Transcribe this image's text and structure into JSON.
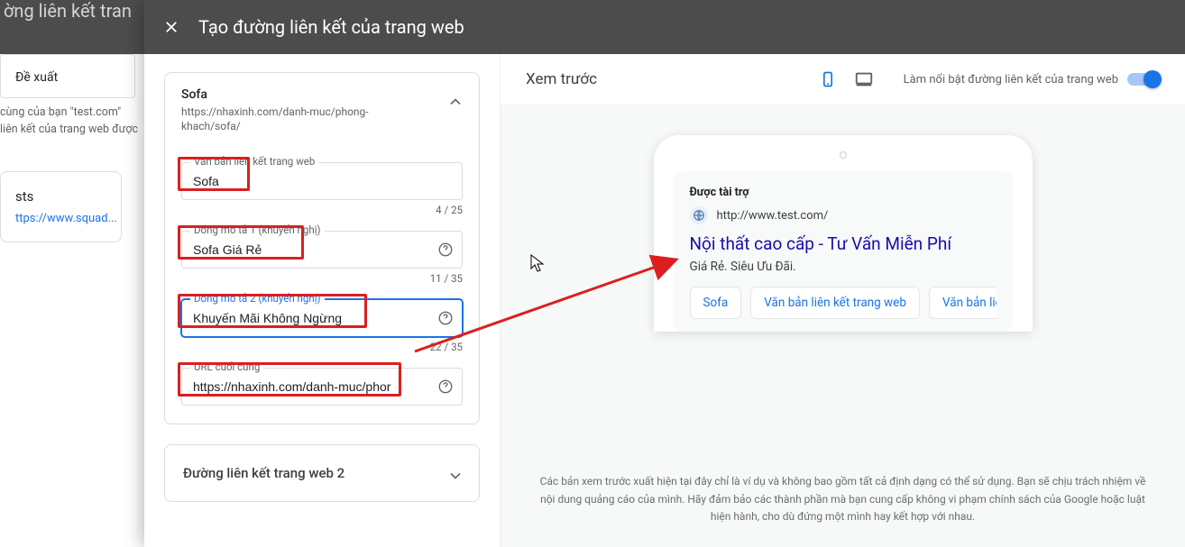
{
  "background": {
    "top_crumb": "ờng liên kết tran",
    "tab": "Đề xuất",
    "line1": "cùng của bạn \"test.com\"",
    "line2": "liên kết của trang web được",
    "card_title": "sts",
    "card_link": "ttps://www.squad..."
  },
  "dialog": {
    "title": "Tạo đường liên kết của trang web",
    "cards": [
      {
        "title": "Sofa",
        "url": "https://nhaxinh.com/danh-muc/phong-khach/sofa/",
        "fields": {
          "link_text": {
            "label": "Văn bản liên kết trang web",
            "value": "Sofa",
            "counter": "4 / 25"
          },
          "desc1": {
            "label": "Dòng mô tả 1 (khuyến nghị)",
            "value": "Sofa Giá Rẻ",
            "counter": "11 / 35"
          },
          "desc2": {
            "label": "Dòng mô tả 2 (khuyến nghị)",
            "value": "Khuyến Mãi Không Ngừng",
            "counter": "22 / 35"
          },
          "final_url": {
            "label": "URL cuối cùng",
            "value": "https://nhaxinh.com/danh-muc/phor"
          }
        }
      }
    ],
    "sitelink2": "Đường liên kết trang web 2"
  },
  "preview": {
    "title": "Xem trước",
    "toggle_label": "Làm nổi bật đường liên kết của trang web",
    "ad": {
      "sponsored": "Được tài trợ",
      "url": "http://www.test.com/",
      "headline": "Nội thất cao cấp - Tư Vấn Miễn Phí",
      "description": "Giá Rẻ. Siêu Ưu Đãi.",
      "chips": [
        "Sofa",
        "Văn bản liên kết trang web",
        "Văn bản liên kết t"
      ]
    },
    "disclaimer": "Các bản xem trước xuất hiện tại đây chỉ là ví dụ và không bao gồm tất cả định dạng có thể sử dụng. Bạn sẽ chịu trách nhiệm về nội dung quảng cáo của mình. Hãy đảm bảo các thành phần mà bạn cung cấp không vi phạm chính sách của Google hoặc luật hiện hành, cho dù đứng một mình hay kết hợp với nhau."
  }
}
